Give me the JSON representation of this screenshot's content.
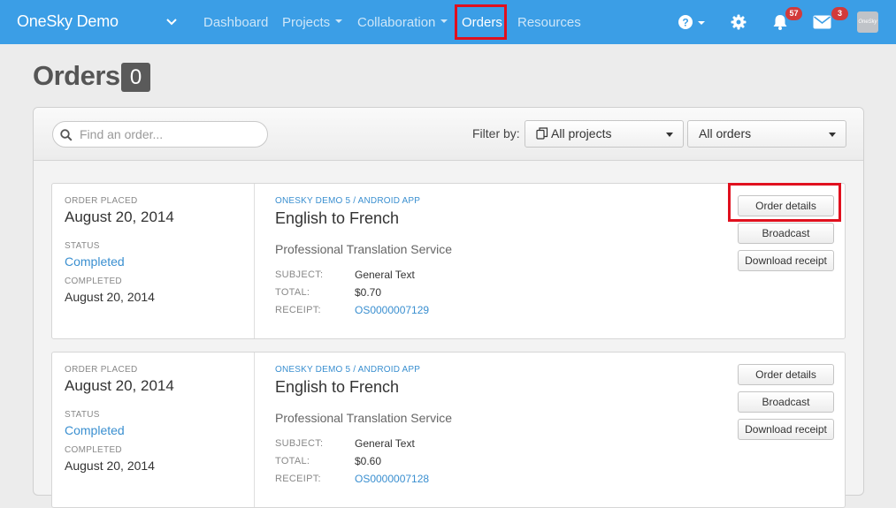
{
  "nav": {
    "brand": "OneSky Demo",
    "items": [
      {
        "label": "Dashboard",
        "has_caret": false
      },
      {
        "label": "Projects",
        "has_caret": true
      },
      {
        "label": "Collaboration",
        "has_caret": true
      },
      {
        "label": "Orders",
        "has_caret": false,
        "active": true
      },
      {
        "label": "Resources",
        "has_caret": false
      }
    ],
    "notifications_count": "57",
    "messages_count": "3",
    "avatar_text": "OneSky",
    "icons": [
      "help-icon",
      "gear-icon",
      "bell-icon",
      "envelope-icon"
    ]
  },
  "page": {
    "title": "Orders",
    "count": "0"
  },
  "toolbar": {
    "search_placeholder": "Find an order...",
    "filter_label": "Filter by:",
    "project_filter": "All projects",
    "order_filter": "All orders"
  },
  "labels": {
    "order_placed": "ORDER PLACED",
    "status": "STATUS",
    "completed": "COMPLETED",
    "subject": "SUBJECT:",
    "total": "TOTAL:",
    "receipt": "RECEIPT:",
    "order_details": "Order details",
    "broadcast": "Broadcast",
    "download_receipt": "Download receipt"
  },
  "orders": [
    {
      "placed": "August 20, 2014",
      "status": "Completed",
      "completed_date": "August 20, 2014",
      "project": "ONESKY DEMO 5",
      "platform": "ANDROID APP",
      "title": "English to French",
      "service": "Professional Translation Service",
      "subject": "General Text",
      "total": "$0.70",
      "receipt": "OS0000007129"
    },
    {
      "placed": "August 20, 2014",
      "status": "Completed",
      "completed_date": "August 20, 2014",
      "project": "ONESKY DEMO 5",
      "platform": "ANDROID APP",
      "title": "English to French",
      "service": "Professional Translation Service",
      "subject": "General Text",
      "total": "$0.60",
      "receipt": "OS0000007128"
    }
  ],
  "colors": {
    "nav_bg": "#3b9ee6",
    "link": "#3a8fd0",
    "highlight": "#e0101e",
    "badge": "#d23a3a"
  }
}
